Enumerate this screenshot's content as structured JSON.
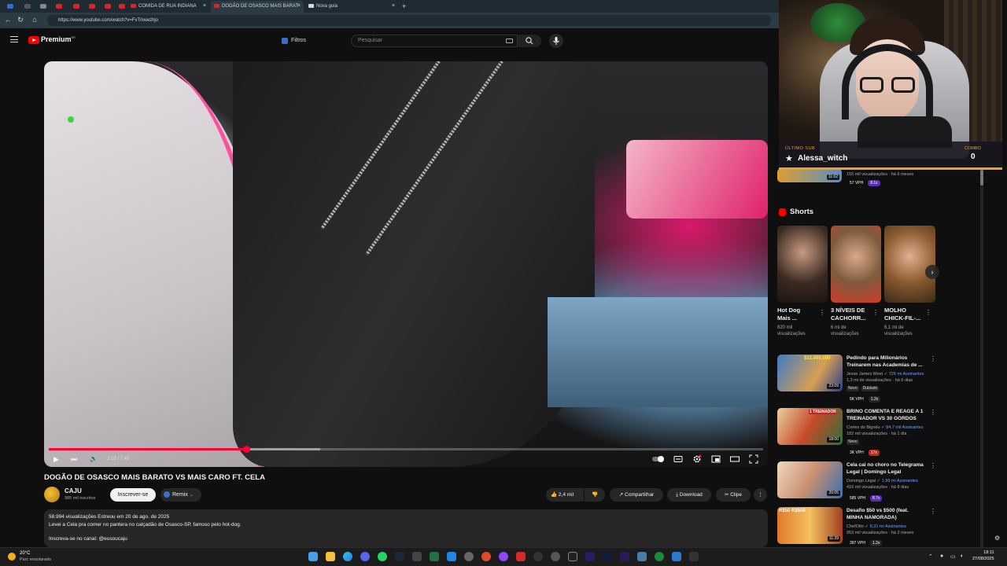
{
  "browser": {
    "tabs": [
      {
        "title": "COMIDA DE RUA INDIANA",
        "active": false
      },
      {
        "title": "DOGÃO DE OSASCO MAIS BARAT",
        "active": true
      },
      {
        "title": "Nova guia",
        "active": false
      }
    ],
    "new_tab": "+",
    "close_glyph": "×",
    "url": "https://www.youtube.com/watch?v=FvTriwwzhjo"
  },
  "youtube": {
    "logo_text": "Premium",
    "logo_region": "BR",
    "filters_label": "Filtros",
    "search_placeholder": "Pesquisar"
  },
  "player": {
    "current_time": "2:10",
    "duration": "7:49",
    "time_display": "2:10 / 7:49",
    "progress_fraction": 0.277,
    "buffered_fraction": 0.38
  },
  "video": {
    "title": "DOGÃO DE OSASCO MAIS BARATO VS MAIS CARO FT. CELA",
    "channel": "CAJU",
    "subscribers": "985 mil inscritos",
    "subscribe_label": "Inscrever-se",
    "remix_label": "Remix",
    "likes": "2,4 mil",
    "share_label": "Compartilhar",
    "download_label": "Download",
    "clip_label": "Clipe",
    "description": {
      "line1": "58.994 visualizações  Estreou em 20 de ago. de 2025",
      "line2": "Levei a Cela pra comer no pantera no calçadão de Osasco-SP, famoso pelo hot-dog.",
      "line3": "Inscreva-se no canal: @eusoucaju"
    }
  },
  "stream_overlay": {
    "label": "ÚLTIMO SUB",
    "name": "Alessa_witch",
    "combo_label": "COMBO",
    "combo_value": "0"
  },
  "sidebar": {
    "top_item": {
      "duration": "11:02",
      "meta": "155 mil visualizações · há 6 meses",
      "vph": "57 VPH",
      "badge": "8.1x"
    },
    "shorts_heading": "Shorts",
    "shorts": [
      {
        "title_line1": "Hot Dog",
        "title_line2": "Mais ...",
        "views_line1": "820 mil",
        "views_line2": "visualizações"
      },
      {
        "title_line1": "3 NÍVEIS DE",
        "title_line2": "CACHORR...",
        "views_line1": "6 mi de",
        "views_line2": "visualizações"
      },
      {
        "title_line1": "MOLHO",
        "title_line2": "CHICK-FIL-...",
        "views_line1": "6,1 mi de",
        "views_line2": "visualizações"
      }
    ],
    "videos": [
      {
        "title_line1": "Pedindo para Milionários",
        "title_line2": "Treinarem nas Academias de ...",
        "channel": "Jesse James West",
        "subs": "726 mi",
        "members": "Assinantes",
        "meta": "1,3 mi de visualizações · há 6 dias",
        "chips": [
          "Novo",
          "Dublado"
        ],
        "duration": "23:09",
        "thumb_text": "$12,000,000",
        "vph": "5K VPH",
        "badge": "1.2x",
        "badge_style": "gray"
      },
      {
        "title_line1": "BRINO COMENTA E REAGE A 1",
        "title_line2": "TREINADOR VS 30 GORDOS",
        "channel": "Cortes do Bigodu",
        "subs": "84,7 mil",
        "members": "Assinantes",
        "meta": "182 mil visualizações · há 1 dia",
        "chips": [
          "Novo"
        ],
        "duration": "18:00",
        "thumb_text": "1 TREINADOR",
        "vph": "3K VPH",
        "badge": "17x",
        "badge_style": "red"
      },
      {
        "title_line1": "Cela cai no choro no Telegrama",
        "title_line2": "Legal | Domingo Legal",
        "channel": "Domingo Legal",
        "subs": "1,99 mi",
        "members": "Assinantes",
        "meta": "416 mil visualizações · há 8 dias",
        "chips": [],
        "duration": "20:05",
        "thumb_text": "",
        "vph": "585 VPH",
        "badge": "8.7x",
        "badge_style": "purple"
      },
      {
        "title_line1": "Desafio $50 vs $500 (feat.",
        "title_line2": "MINHA NAMORADA)",
        "channel": "ChefOtto",
        "subs": "8,31 mi",
        "members": "Assinantes",
        "meta": "953 mil visualizações · há 2 meses",
        "chips": [],
        "duration": "11:39",
        "thumb_text": "R$50 R$500",
        "vph": "397 VPH",
        "badge": "1.2x",
        "badge_style": "gray"
      }
    ]
  },
  "taskbar": {
    "temperature": "20°C",
    "weather": "Parc ensolarado",
    "time": "18:11",
    "date": "27/08/2025"
  },
  "icons": {
    "kebab": "⋮",
    "chevron": "›",
    "star": "★",
    "play": "▶",
    "next": "⏭",
    "volume": "🔊",
    "dislike": "👎",
    "like": "👍"
  },
  "colors": {
    "accent_red": "#ff0033",
    "yt_bg": "#0f0f0f",
    "overlay_orange": "#f0a030"
  }
}
